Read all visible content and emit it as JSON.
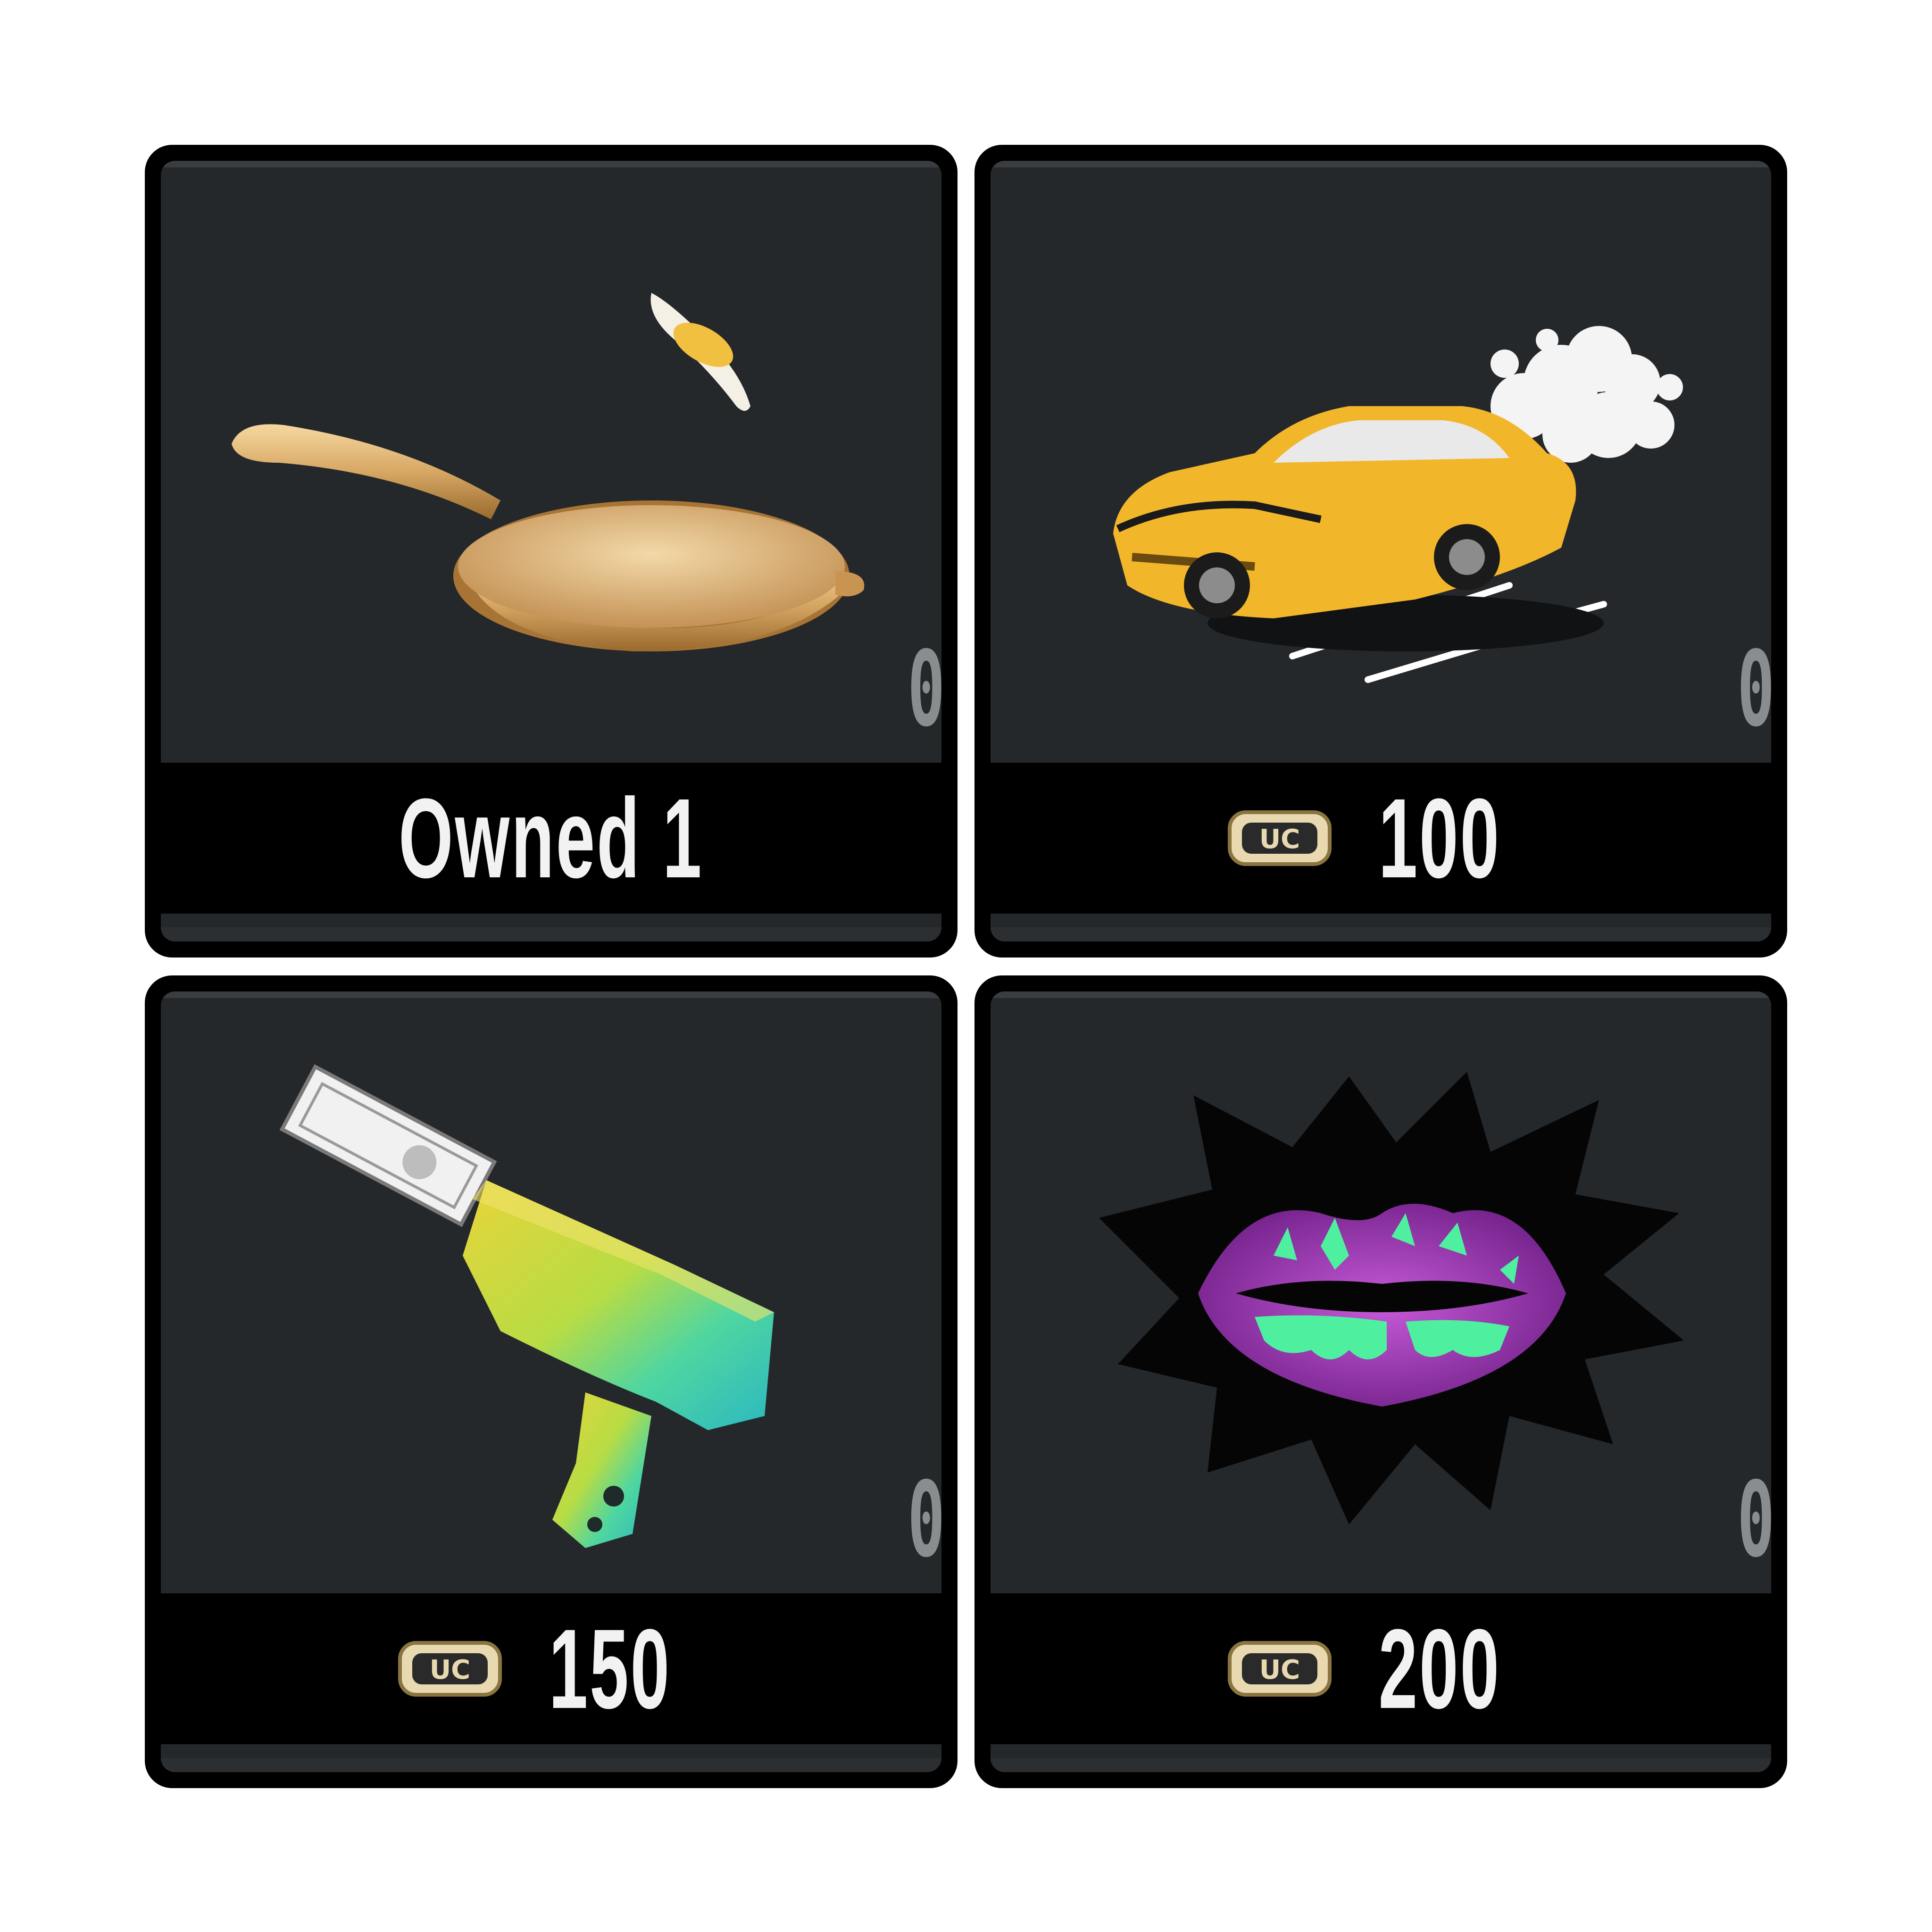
{
  "items": [
    {
      "name": "golden-pan",
      "icon": "frying-pan-icon",
      "price_label": "Owned 1",
      "show_currency": false,
      "corner_value": "0/"
    },
    {
      "name": "yellow-car",
      "icon": "car-icon",
      "price_label": "100",
      "show_currency": true,
      "corner_value": "0"
    },
    {
      "name": "money-gun",
      "icon": "money-gun-icon",
      "price_label": "150",
      "show_currency": true,
      "corner_value": "0/"
    },
    {
      "name": "purple-lips",
      "icon": "lips-icon",
      "price_label": "200",
      "show_currency": true,
      "corner_value": "0"
    }
  ],
  "currency": {
    "label": "UC",
    "icon": "uc-currency-icon"
  },
  "colors": {
    "card_bg": "#25282b",
    "price_bar_bg": "#000000",
    "text": "#f2f2f2",
    "gold": "#d9a441",
    "purple": "#a13fb8",
    "neon_green": "#4ef0a0"
  }
}
